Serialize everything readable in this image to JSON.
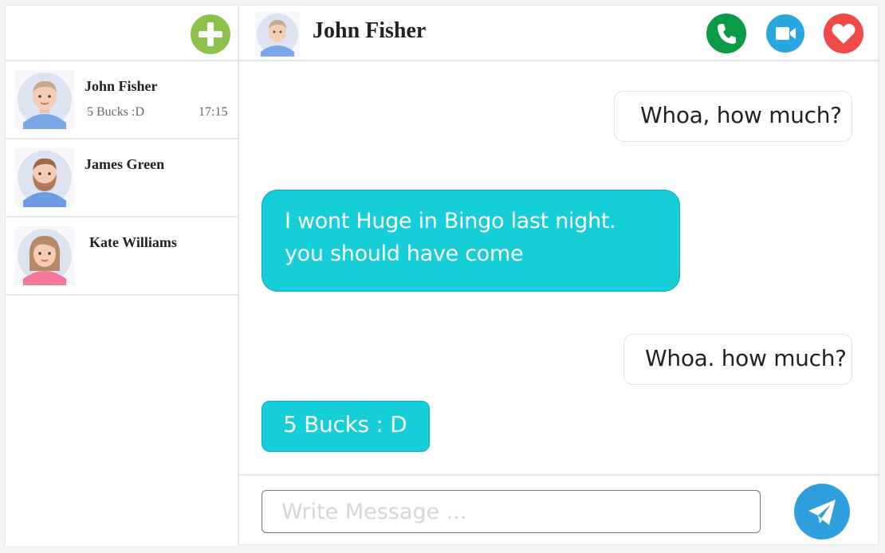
{
  "colors": {
    "add": "#8bc34a",
    "call": "#0a9a45",
    "video": "#2aa7e0",
    "heart": "#ef4a4a",
    "incoming_bubble": "#15ced8",
    "send": "#2e9fdc"
  },
  "sidebar": {
    "add_icon": "plus-icon",
    "contacts": [
      {
        "name": "John Fisher",
        "preview": "5 Bucks :D",
        "time": "17:15",
        "avatar": "man-avatar"
      },
      {
        "name": "James Green",
        "preview": "",
        "time": "",
        "avatar": "bearded-man-avatar"
      },
      {
        "name": "Kate Williams",
        "preview": "",
        "time": "",
        "avatar": "woman-avatar"
      }
    ]
  },
  "chat": {
    "title": "John Fisher",
    "icons": {
      "call": "phone-icon",
      "video": "video-camera-icon",
      "favorite": "heart-icon",
      "send": "paper-plane-icon"
    },
    "messages": [
      {
        "direction": "outgoing",
        "text": "Whoa, how much?"
      },
      {
        "direction": "incoming",
        "text": "I wont Huge in Bingo last night. you should have come"
      },
      {
        "direction": "outgoing",
        "text": "Whoa. how much?"
      },
      {
        "direction": "incoming",
        "text": "5 Bucks : D"
      }
    ],
    "composer": {
      "placeholder": "Write Message ...",
      "value": ""
    }
  }
}
